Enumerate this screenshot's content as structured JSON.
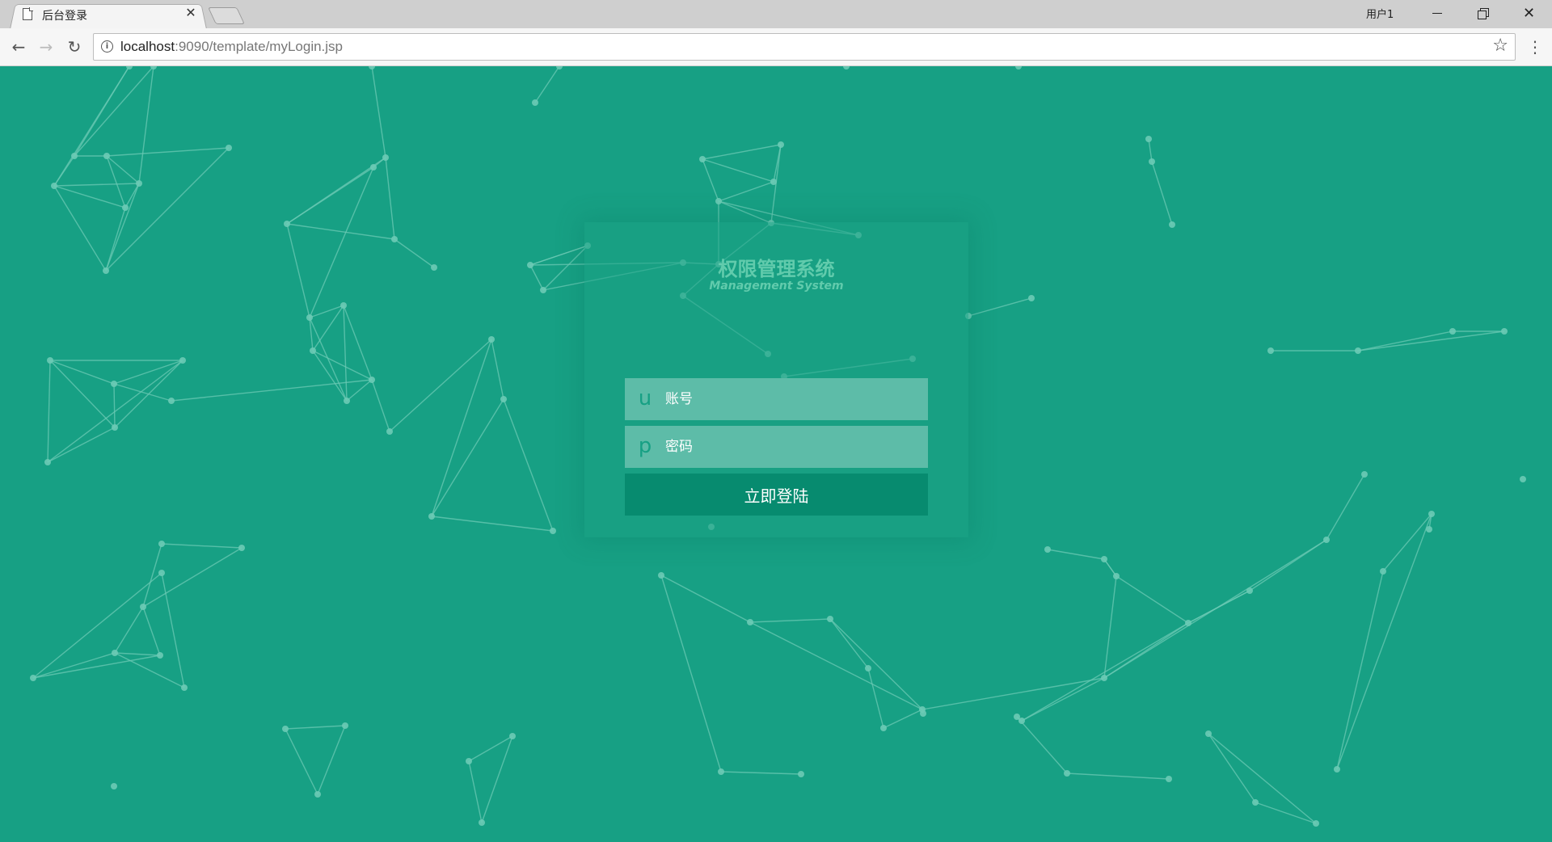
{
  "window": {
    "tab_title": "后台登录",
    "profile_name": "用户1"
  },
  "toolbar": {
    "url_host": "localhost",
    "url_rest": ":9090/template/myLogin.jsp"
  },
  "login": {
    "title": "权限管理系统",
    "subtitle": "Management System",
    "username_icon": "u",
    "username_placeholder": "账号",
    "password_icon": "p",
    "password_placeholder": "密码",
    "submit_label": "立即登陆"
  },
  "icons": {
    "tab_page": "page-icon",
    "tab_close": "close-icon",
    "back": "back-arrow-icon",
    "forward": "forward-arrow-icon",
    "reload": "reload-icon",
    "site_info": "info-icon",
    "bookmark": "star-icon",
    "menu": "kebab-menu-icon"
  },
  "colors": {
    "background": "#17a084",
    "field": "#5dbca8",
    "button": "#078b6f",
    "network": "#6ccab5"
  }
}
